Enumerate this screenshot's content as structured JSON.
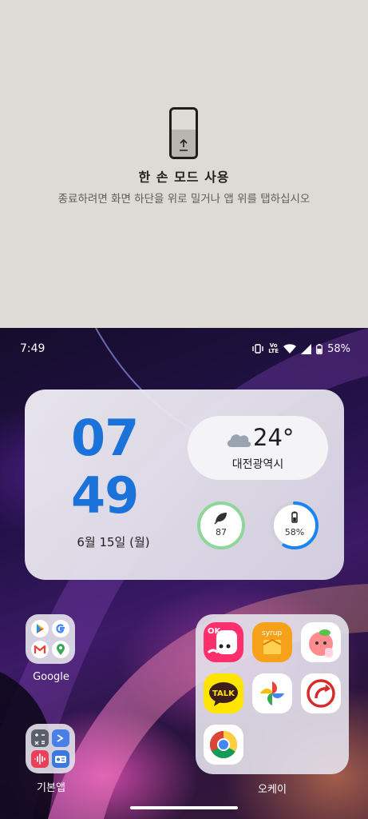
{
  "one_hand_mode": {
    "title": "한 손 모드 사용",
    "description": "종료하려면 화면 하단을 위로 밀거나 앱 위를 탭하십시오",
    "icon": "phone-swipe-up-icon"
  },
  "status_bar": {
    "time": "7:49",
    "volte_line1": "Vo",
    "volte_line2": "LTE",
    "battery": "58%",
    "icons": [
      "vibrate-icon",
      "volte-icon",
      "wifi-icon",
      "signal-icon",
      "battery-icon"
    ]
  },
  "widget": {
    "clock_hours": "07",
    "clock_minutes": "49",
    "date": "6월 15일 (월)",
    "weather_temp": "24°",
    "weather_city": "대전광역시",
    "weather_icon": "cloud-icon",
    "left_ring_value": "87",
    "left_ring_icon": "leaf-icon",
    "right_ring_value": "58%",
    "right_ring_icon": "battery-icon",
    "clock_color": "#1b73d9",
    "left_ring_color": "#8fd69a",
    "right_ring_color": "#1a85f0"
  },
  "folders": {
    "google": {
      "label": "Google",
      "apps": [
        "play-store-icon",
        "google-icon",
        "gmail-icon",
        "maps-icon"
      ]
    },
    "basic": {
      "label": "기본앱",
      "apps": [
        "calculator-icon",
        "terminal-icon",
        "voice-recorder-icon",
        "radio-icon"
      ]
    },
    "big": {
      "label": "오케이",
      "apps": [
        "ok-cashbag-app",
        "syrup-app",
        "peach-character-app",
        "kakaotalk-app",
        "google-photos-app",
        "red-swirl-app",
        "chrome-app"
      ],
      "syrup_text": "syrup",
      "ok_text": "OK",
      "talk_text": "TALK"
    }
  }
}
